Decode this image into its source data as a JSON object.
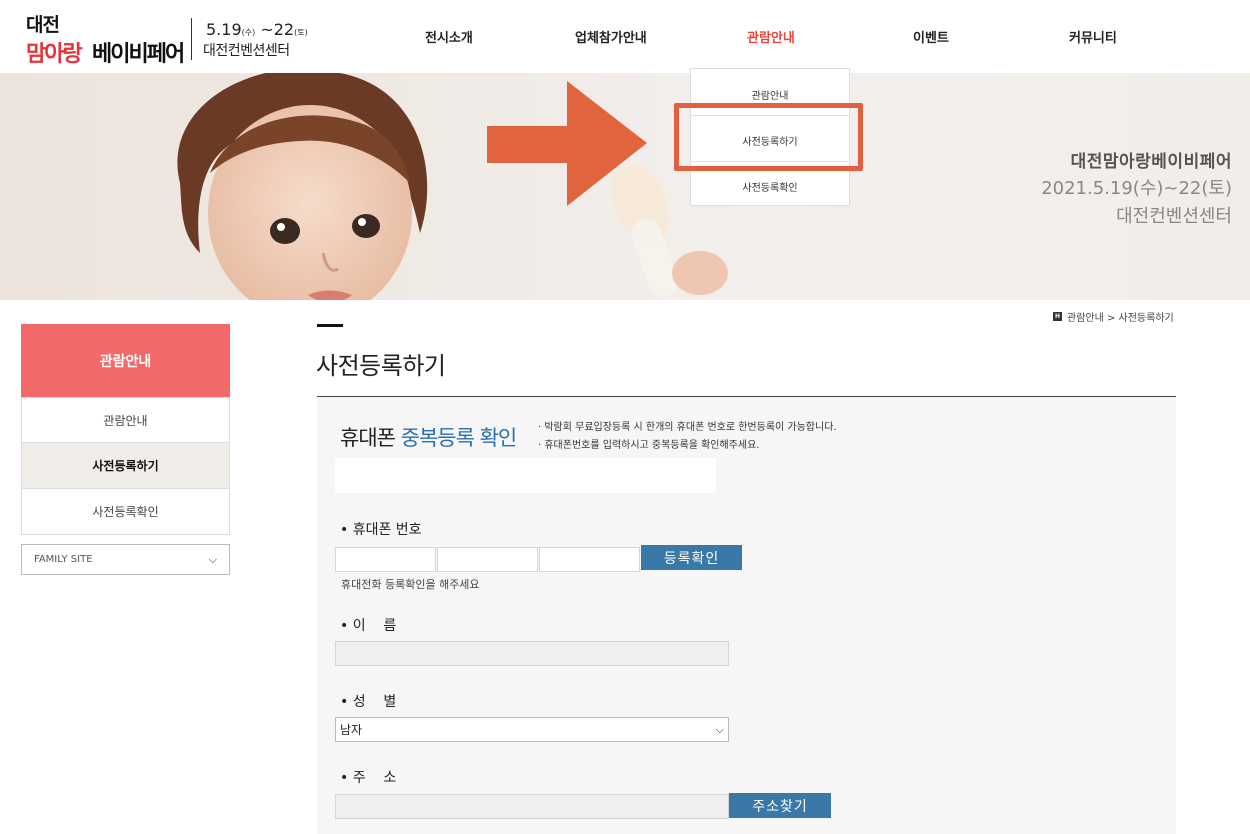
{
  "header": {
    "logo_top": "대전",
    "logo_pink": "맘아랑",
    "logo_black": "베이비페어",
    "date_start": "5.19",
    "date_start_day": "(수)",
    "date_sep": " ~",
    "date_end": "22",
    "date_end_day": "(토)",
    "venue": "대전컨벤션센터",
    "nav": [
      "전시소개",
      "업체참가안내",
      "관람안내",
      "이벤트",
      "커뮤니티"
    ],
    "dropdown": [
      "관람안내",
      "사전등록하기",
      "사전등록확인"
    ]
  },
  "banner": {
    "title": "대전맘아랑베이비페어",
    "date": "2021.5.19(수)~22(토)",
    "venue": "대전컨벤션센터"
  },
  "sidebar": {
    "heading": "관람안내",
    "items": [
      "관람안내",
      "사전등록하기",
      "사전등록확인"
    ],
    "family_site": "FAMILY SITE"
  },
  "breadcrumb": {
    "icon": "H",
    "text": "관람안내 > 사전등록하기"
  },
  "main": {
    "title": "사전등록하기",
    "section_head_plain": "휴대폰 ",
    "section_head_blue": "중복등록 확인",
    "notes": [
      "· 박람회 무료입장등록 시 한개의 휴대폰 번호로 한번등록이 가능합니다.",
      "· 휴대폰번호를 입력하시고 중복등록을 확인해주세요."
    ],
    "phone_label": "• 휴대폰 번호",
    "check_button": "등록확인",
    "phone_hint": "휴대전화 등록확인을 해주세요",
    "name_label": "• 이    름",
    "gender_label": "• 성    별",
    "gender_value": "남자",
    "address_label": "• 주    소",
    "address_button": "주소찾기"
  },
  "colors": {
    "accent_red": "#e8453c",
    "sidebar_head": "#f3696a",
    "button_blue": "#3a78a7",
    "highlight_box": "#e2603f"
  }
}
